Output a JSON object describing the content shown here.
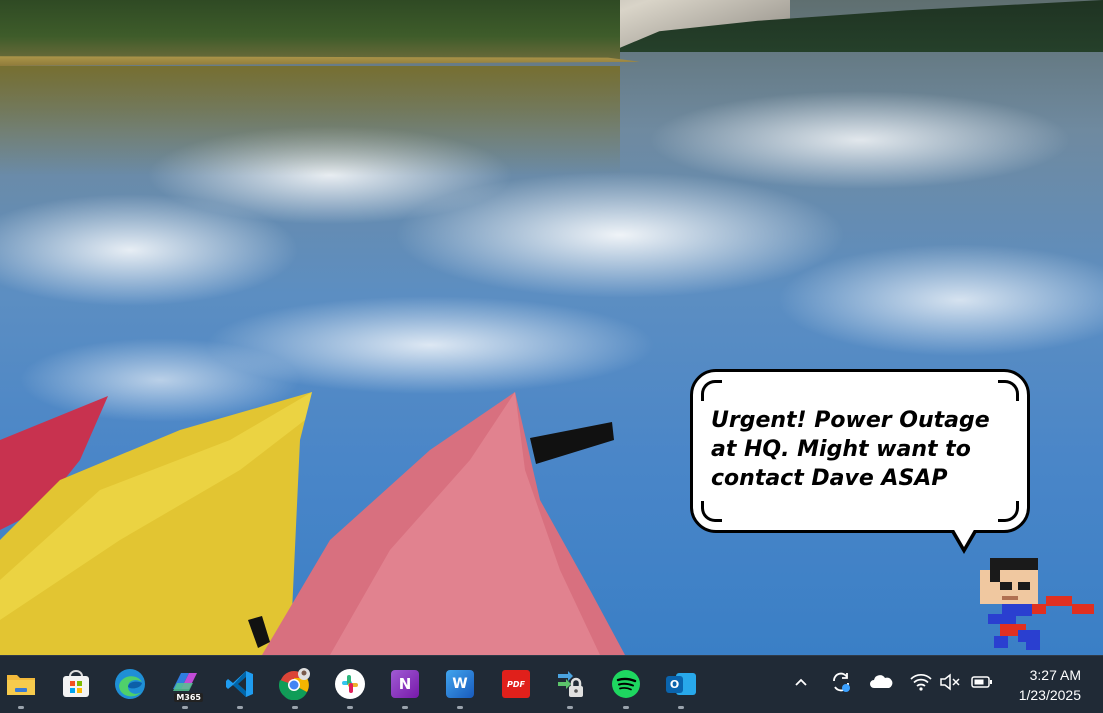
{
  "notification": {
    "message": "Urgent! Power Outage at HQ. Might want to contact Dave ASAP"
  },
  "taskbar": {
    "apps": [
      {
        "name": "File Explorer",
        "icon": "folder-icon"
      },
      {
        "name": "Microsoft Store",
        "icon": "store-icon"
      },
      {
        "name": "Microsoft Edge",
        "icon": "edge-icon"
      },
      {
        "name": "Microsoft 365 Copilot",
        "icon": "m365-icon",
        "badge": "M365"
      },
      {
        "name": "Visual Studio Code",
        "icon": "vscode-icon"
      },
      {
        "name": "Google Chrome",
        "icon": "chrome-icon"
      },
      {
        "name": "Slack",
        "icon": "slack-icon"
      },
      {
        "name": "OneNote",
        "icon": "onenote-icon",
        "letter": "N"
      },
      {
        "name": "Word",
        "icon": "word-icon",
        "letter": "W"
      },
      {
        "name": "PDF Reader",
        "icon": "pdf-icon",
        "letter": "PDF"
      },
      {
        "name": "Secure Transfer",
        "icon": "lock-transfer-icon"
      },
      {
        "name": "Spotify",
        "icon": "spotify-icon"
      },
      {
        "name": "Outlook",
        "icon": "outlook-icon",
        "letter": "O"
      }
    ],
    "tray": {
      "icons": [
        "chevron-up-icon",
        "sync-icon",
        "onedrive-cloud-icon",
        "wifi-icon",
        "volume-muted-icon",
        "battery-icon"
      ]
    },
    "clock": {
      "time": "3:27 AM",
      "date": "1/23/2025"
    }
  }
}
